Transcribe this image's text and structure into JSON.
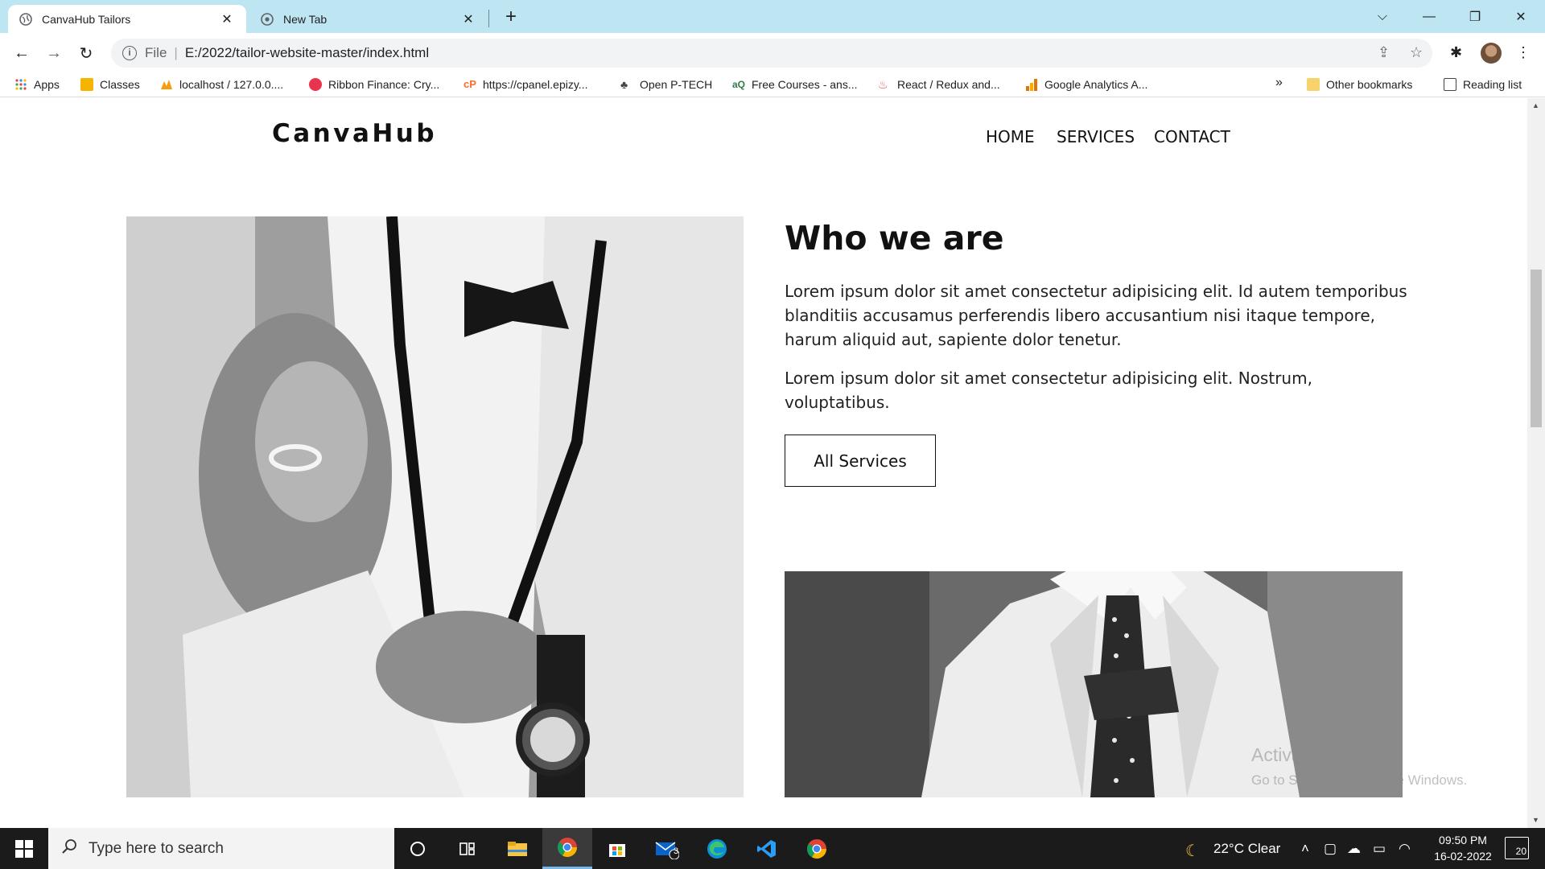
{
  "browser": {
    "tabs": [
      {
        "title": "CanvaHub Tailors",
        "active": true
      },
      {
        "title": "New Tab",
        "active": false
      }
    ],
    "address": {
      "scheme": "File",
      "url": "E:/2022/tailor-website-master/index.html"
    },
    "bookmarks": [
      {
        "label": "Apps",
        "icon": "apps-grid-icon"
      },
      {
        "label": "Classes",
        "icon": "classroom-icon"
      },
      {
        "label": "localhost / 127.0.0....",
        "icon": "phpmyadmin-icon"
      },
      {
        "label": "Ribbon Finance: Cry...",
        "icon": "ribbon-icon"
      },
      {
        "label": "https://cpanel.epizy...",
        "icon": "cpanel-icon"
      },
      {
        "label": "Open P-TECH",
        "icon": "ptech-icon"
      },
      {
        "label": "Free Courses - ans...",
        "icon": "courses-icon"
      },
      {
        "label": "React / Redux and...",
        "icon": "udemy-icon"
      },
      {
        "label": "Google Analytics A...",
        "icon": "analytics-icon"
      }
    ],
    "overflow_label": "»",
    "other_bookmarks": "Other bookmarks",
    "reading_list": "Reading list"
  },
  "site": {
    "logo": "CanvaHub",
    "nav": [
      "HOME",
      "SERVICES",
      "CONTACT"
    ],
    "about": {
      "title": "Who we are",
      "para1": "Lorem ipsum dolor sit amet consectetur adipisicing elit. Id autem temporibus blanditiis accusamus perferendis libero accusantium nisi itaque tempore, harum aliquid aut, sapiente dolor tenetur.",
      "para2": "Lorem ipsum dolor sit amet consectetur adipisicing elit. Nostrum, voluptatibus.",
      "button": "All Services"
    }
  },
  "watermark": {
    "line1": "Activate Windows",
    "line2": "Go to Settings to activate Windows."
  },
  "taskbar": {
    "search_placeholder": "Type here to search",
    "weather": "22°C  Clear",
    "time": "09:50 PM",
    "date": "16-02-2022",
    "mail_badge": "3",
    "notifications": "20"
  },
  "colors": {
    "tabbar": "#bde6f2",
    "taskbar": "#1b1b1b",
    "accent": "#111111"
  }
}
